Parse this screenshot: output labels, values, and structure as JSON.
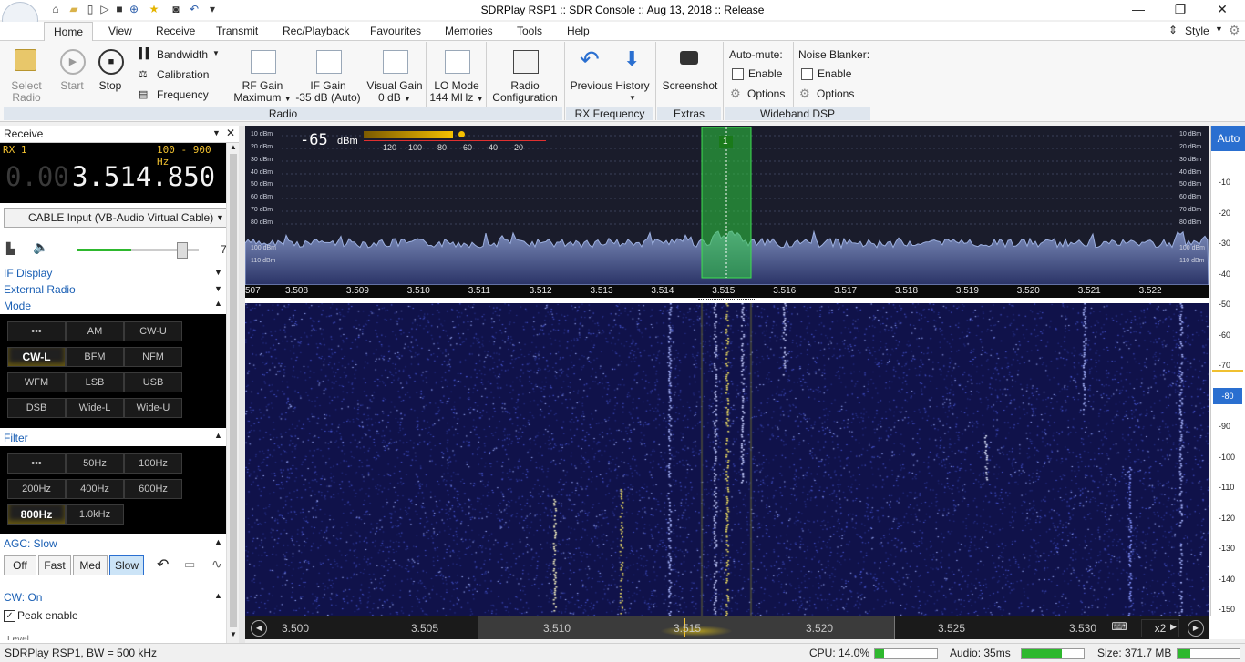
{
  "window": {
    "title": "SDRPlay RSP1 :: SDR Console :: Aug 13, 2018 :: Release"
  },
  "tabs": [
    "Home",
    "View",
    "Receive",
    "Transmit",
    "Rec/Playback",
    "Favourites",
    "Memories",
    "Tools",
    "Help"
  ],
  "style_label": "Style",
  "ribbon": {
    "select_radio": [
      "Select",
      "Radio"
    ],
    "start": "Start",
    "stop": "Stop",
    "bandwidth": "Bandwidth",
    "calibration": "Calibration",
    "frequency": "Frequency",
    "rf_gain": [
      "RF Gain",
      "Maximum"
    ],
    "if_gain": [
      "IF Gain",
      "-35 dB (Auto)"
    ],
    "visual_gain": [
      "Visual Gain",
      "0 dB"
    ],
    "lo_mode": [
      "LO Mode",
      "144 MHz"
    ],
    "radio_config": [
      "Radio",
      "Configuration"
    ],
    "previous": "Previous",
    "history": "History",
    "screenshot": "Screenshot",
    "automute": "Auto-mute:",
    "noise_blanker": "Noise Blanker:",
    "enable": "Enable",
    "options": "Options",
    "groups": {
      "radio": "Radio",
      "rxfreq": "RX Frequency",
      "extras": "Extras",
      "wideband": "Wideband DSP"
    }
  },
  "left": {
    "receive": "Receive",
    "rx": "RX 1",
    "filter_range": "100 - 900 Hz",
    "freq_dim": "0.00",
    "freq_main": "3.514.850",
    "input": "CABLE Input (VB-Audio Virtual Cable)",
    "volume_value": "7",
    "volume": 0.45,
    "if_display": "IF Display",
    "external_radio": "External Radio",
    "mode": "Mode",
    "modes": [
      "•••",
      "AM",
      "CW-U",
      "CW-L",
      "BFM",
      "NFM",
      "WFM",
      "LSB",
      "USB",
      "DSB",
      "Wide-L",
      "Wide-U"
    ],
    "filter": "Filter",
    "filters": [
      "•••",
      "50Hz",
      "100Hz",
      "200Hz",
      "400Hz",
      "600Hz",
      "800Hz",
      "1.0kHz"
    ],
    "agc": "AGC: Slow",
    "agc_buttons": [
      "Off",
      "Fast",
      "Med",
      "Slow"
    ],
    "cw": "CW: On",
    "peak_enable": "Peak enable",
    "level_partial": "Level"
  },
  "spectrum": {
    "signal": "-65",
    "signal_unit": "dBm",
    "meter_scale": [
      "-120",
      "-100",
      "-80",
      "-60",
      "-40",
      "-20"
    ],
    "dbm_labels": [
      "10 dBm",
      "20 dBm",
      "30 dBm",
      "40 dBm",
      "50 dBm",
      "60 dBm",
      "70 dBm",
      "80 dBm",
      "100 dBm",
      "110 dBm"
    ],
    "marker": "1",
    "freq_ticks": [
      "507",
      "3.508",
      "3.509",
      "3.510",
      "3.511",
      "3.512",
      "3.513",
      "3.514",
      "3.515",
      "3.516",
      "3.517",
      "3.518",
      "3.519",
      "3.520",
      "3.521",
      "3.522"
    ]
  },
  "right_scale": {
    "auto": "Auto",
    "ticks": [
      "-10",
      "-20",
      "-30",
      "-40",
      "-50",
      "-60",
      "-70",
      "-80",
      "-90",
      "-100",
      "-110",
      "-120",
      "-130",
      "-140",
      "-150"
    ],
    "selected": "-80"
  },
  "bottom": {
    "ticks": [
      "3.500",
      "3.505",
      "3.510",
      "3.515",
      "3.520",
      "3.525",
      "3.530"
    ],
    "zoom": "x2"
  },
  "status": {
    "left": "SDRPlay RSP1, BW = 500 kHz",
    "cpu": "CPU: 14.0%",
    "cpu_level": 0.14,
    "audio": "Audio: 35ms",
    "audio_level": 0.65,
    "size": "Size: 371.7 MB",
    "size_level": 0.2
  },
  "colors": {
    "accent": "#1a5fb4",
    "spectrum_bg": "#1a1c2b",
    "waterfall_bg": "#10124a",
    "filter_green": "#2ecc40"
  }
}
